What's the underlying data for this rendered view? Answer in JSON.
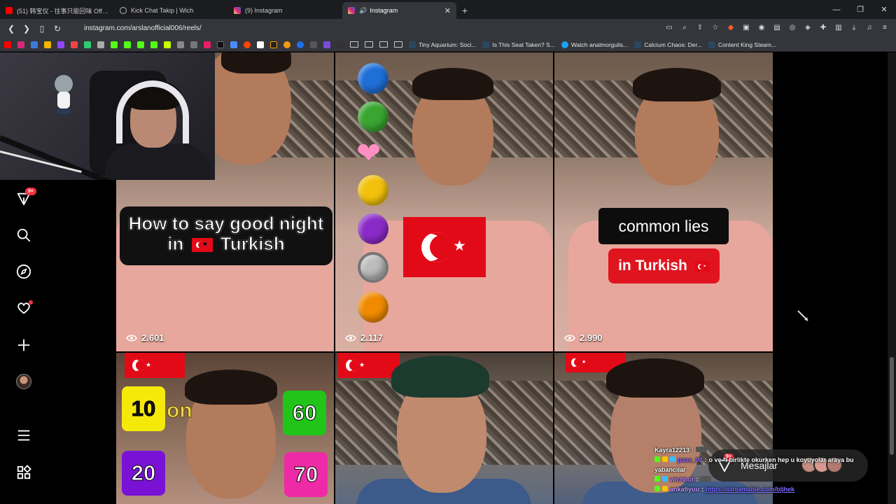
{
  "tabs": [
    {
      "title": "(51) 韩宝仪 - 往事只能回味 Official M",
      "icon": "youtube-icon",
      "color": "#ff0000"
    },
    {
      "title": "Kick Chat Takip | Wich",
      "icon": "globe-icon",
      "color": "#bdbdbd"
    },
    {
      "title": "(9) Instagram",
      "icon": "instagram-icon",
      "color": "#e1306c"
    },
    {
      "title": "Instagram",
      "icon": "instagram-icon",
      "color": "#e1306c",
      "active": true
    }
  ],
  "window_controls": [
    "—",
    "❐",
    "✕"
  ],
  "url": "instagram.com/arslanofficial006/reels/",
  "bookmarks": [
    {
      "label": "Tiny Aquarium: Soci..."
    },
    {
      "label": "Is This Seat Taken? S..."
    },
    {
      "label": "Watch analmorgulis..."
    },
    {
      "label": "Calcium Chaos: Der..."
    },
    {
      "label": "Content King Steam..."
    }
  ],
  "sidebar": {
    "notifications_badge": "9+"
  },
  "reels": [
    {
      "views": "2.601",
      "caption_line1": "How to say good night",
      "caption_line2_pre": "in",
      "caption_line2_post": "Turkish"
    },
    {
      "views": "2.117"
    },
    {
      "views": "2.990",
      "caption_a": "common lies",
      "caption_b": "in Turkish"
    },
    {
      "numbers": [
        "10",
        "on",
        "60",
        "20",
        "70"
      ]
    },
    {},
    {}
  ],
  "chat": [
    {
      "user": "Kayra12213",
      "text": ""
    },
    {
      "user": "pasa_02",
      "text": "o ve *i birlikte okurken hep u koyuyolar araya bu"
    },
    {
      "user": "",
      "text": "yabancılar"
    },
    {
      "user": "wichbot",
      "text": ""
    },
    {
      "user": "ankafiyuu",
      "text": "",
      "link": "https://streamable.com/bljhek"
    }
  ],
  "messages": {
    "label": "Mesajlar",
    "badge": "9+"
  }
}
